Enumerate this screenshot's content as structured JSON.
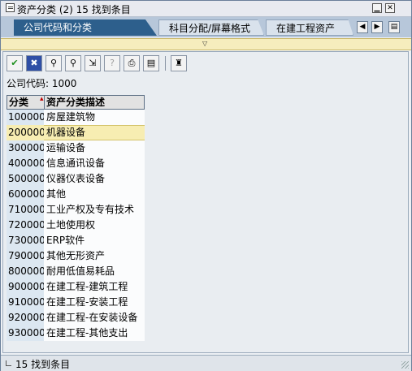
{
  "window": {
    "title": "资产分类 (2)   15 找到条目"
  },
  "tabs": [
    {
      "label": "公司代码和分类",
      "active": true
    },
    {
      "label": "科目分配/屏幕格式",
      "active": false
    },
    {
      "label": "在建工程资产",
      "active": false
    }
  ],
  "toolbar": {
    "tools": [
      {
        "icon": "check-icon",
        "glyph": "✔"
      },
      {
        "icon": "cancel-icon",
        "glyph": "✖"
      },
      {
        "icon": "binoculars-icon",
        "glyph": "⚲"
      },
      {
        "icon": "find-next-icon",
        "glyph": "⚲"
      },
      {
        "icon": "export-icon",
        "glyph": "⇲"
      },
      {
        "icon": "help-icon",
        "glyph": "?"
      },
      {
        "icon": "print-icon",
        "glyph": "⎙"
      },
      {
        "icon": "settings-icon",
        "glyph": "▤"
      },
      {
        "icon": "personal-list-icon",
        "glyph": "♜"
      }
    ]
  },
  "company_code": {
    "text": "公司代码: 1000"
  },
  "table": {
    "headers": [
      "分类",
      "资产分类描述"
    ],
    "rows": [
      {
        "code": "100000",
        "desc": "房屋建筑物",
        "selected": false
      },
      {
        "code": "200000",
        "desc": "机器设备",
        "selected": true
      },
      {
        "code": "300000",
        "desc": "运输设备",
        "selected": false
      },
      {
        "code": "400000",
        "desc": "信息通讯设备",
        "selected": false
      },
      {
        "code": "500000",
        "desc": "仪器仪表设备",
        "selected": false
      },
      {
        "code": "600000",
        "desc": "其他",
        "selected": false
      },
      {
        "code": "710000",
        "desc": "工业产权及专有技术",
        "selected": false
      },
      {
        "code": "720000",
        "desc": "土地使用权",
        "selected": false
      },
      {
        "code": "730000",
        "desc": "ERP软件",
        "selected": false
      },
      {
        "code": "790000",
        "desc": "其他无形资产",
        "selected": false
      },
      {
        "code": "800000",
        "desc": "耐用低值易耗品",
        "selected": false
      },
      {
        "code": "900000",
        "desc": "在建工程-建筑工程",
        "selected": false
      },
      {
        "code": "910000",
        "desc": "在建工程-安装工程",
        "selected": false
      },
      {
        "code": "920000",
        "desc": "在建工程-在安装设备",
        "selected": false
      },
      {
        "code": "930000",
        "desc": "在建工程-其他支出",
        "selected": false
      }
    ]
  },
  "status": {
    "text": "15 找到条目"
  },
  "colors": {
    "active_tab": "#2d5f8c",
    "selected_row": "#f7edb2",
    "key_column": "#dce7f1"
  }
}
